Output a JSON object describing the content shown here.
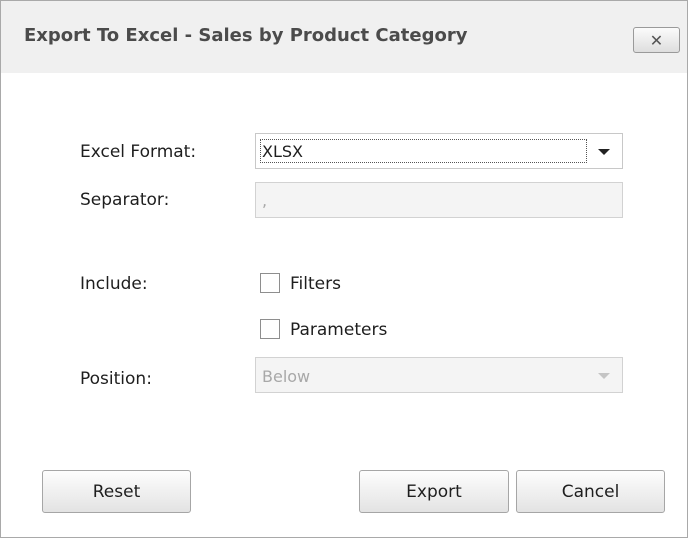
{
  "dialog": {
    "title": "Export To Excel - Sales by Product Category",
    "close_glyph": "✕"
  },
  "form": {
    "excel_format_label": "Excel Format:",
    "excel_format_value": "XLSX",
    "separator_label": "Separator:",
    "separator_value": ",",
    "include_label": "Include:",
    "filters_label": "Filters",
    "filters_checked": false,
    "parameters_label": "Parameters",
    "parameters_checked": false,
    "position_label": "Position:",
    "position_value": "Below"
  },
  "buttons": {
    "reset": "Reset",
    "export": "Export",
    "cancel": "Cancel"
  }
}
